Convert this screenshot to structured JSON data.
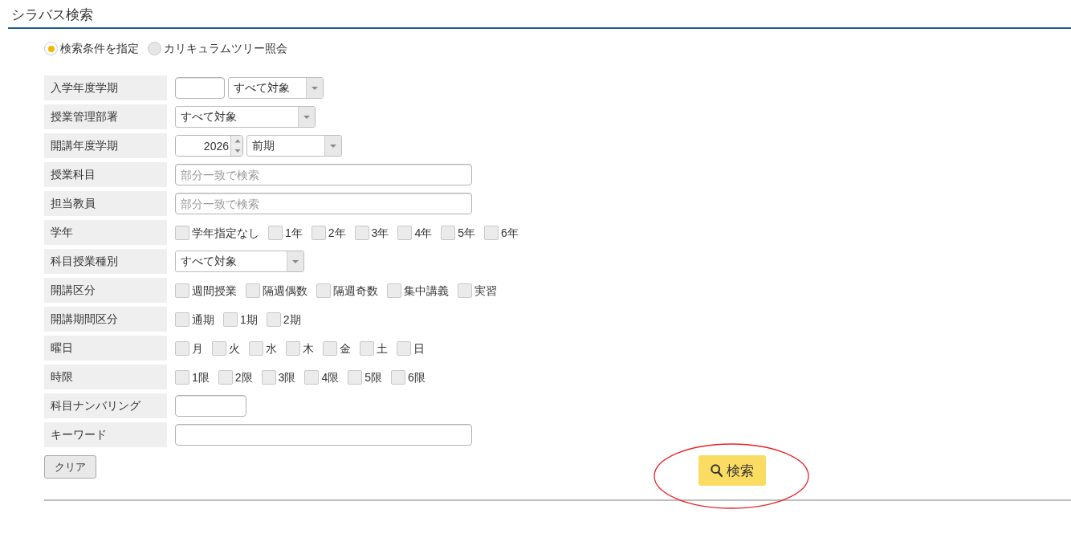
{
  "page_title": "シラバス検索",
  "search_modes": [
    {
      "label": "検索条件を指定",
      "selected": true
    },
    {
      "label": "カリキュラムツリー照会",
      "selected": false
    }
  ],
  "fields": [
    {
      "label": "入学年度学期",
      "controls": [
        {
          "kind": "input"
        },
        {
          "kind": "select",
          "value": "すべて対象"
        }
      ]
    },
    {
      "label": "授業管理部署",
      "controls": [
        {
          "kind": "select",
          "value": "すべて対象"
        }
      ]
    },
    {
      "label": "開講年度学期",
      "controls": [
        {
          "kind": "spinner",
          "value": "2026"
        },
        {
          "kind": "select",
          "value": "前期"
        }
      ]
    },
    {
      "label": "授業科目",
      "controls": [
        {
          "kind": "input",
          "placeholder": "部分一致で検索"
        }
      ]
    },
    {
      "label": "担当教員",
      "controls": [
        {
          "kind": "input",
          "placeholder": "部分一致で検索"
        }
      ]
    },
    {
      "label": "学年",
      "controls": [
        {
          "kind": "checkbox",
          "label": "学年指定なし",
          "checked": false
        },
        {
          "kind": "checkbox",
          "label": "1年",
          "checked": false
        },
        {
          "kind": "checkbox",
          "label": "2年",
          "checked": false
        },
        {
          "kind": "checkbox",
          "label": "3年",
          "checked": false
        },
        {
          "kind": "checkbox",
          "label": "4年",
          "checked": false
        },
        {
          "kind": "checkbox",
          "label": "5年",
          "checked": false
        },
        {
          "kind": "checkbox",
          "label": "6年",
          "checked": false
        }
      ]
    },
    {
      "label": "科目授業種別",
      "controls": [
        {
          "kind": "select",
          "value": "すべて対象"
        }
      ]
    },
    {
      "label": "開講区分",
      "controls": [
        {
          "kind": "checkbox",
          "label": "週間授業",
          "checked": false
        },
        {
          "kind": "checkbox",
          "label": "隔週偶数",
          "checked": false
        },
        {
          "kind": "checkbox",
          "label": "隔週奇数",
          "checked": false
        },
        {
          "kind": "checkbox",
          "label": "集中講義",
          "checked": false
        },
        {
          "kind": "checkbox",
          "label": "実習",
          "checked": false
        }
      ]
    },
    {
      "label": "開講期間区分",
      "controls": [
        {
          "kind": "checkbox",
          "label": "通期",
          "checked": false
        },
        {
          "kind": "checkbox",
          "label": "1期",
          "checked": false
        },
        {
          "kind": "checkbox",
          "label": "2期",
          "checked": false
        }
      ]
    },
    {
      "label": "曜日",
      "controls": [
        {
          "kind": "checkbox",
          "label": "月",
          "checked": false
        },
        {
          "kind": "checkbox",
          "label": "火",
          "checked": false
        },
        {
          "kind": "checkbox",
          "label": "水",
          "checked": false
        },
        {
          "kind": "checkbox",
          "label": "木",
          "checked": false
        },
        {
          "kind": "checkbox",
          "label": "金",
          "checked": false
        },
        {
          "kind": "checkbox",
          "label": "土",
          "checked": false
        },
        {
          "kind": "checkbox",
          "label": "日",
          "checked": false
        }
      ]
    },
    {
      "label": "時限",
      "controls": [
        {
          "kind": "checkbox",
          "label": "1限",
          "checked": false
        },
        {
          "kind": "checkbox",
          "label": "2限",
          "checked": false
        },
        {
          "kind": "checkbox",
          "label": "3限",
          "checked": false
        },
        {
          "kind": "checkbox",
          "label": "4限",
          "checked": false
        },
        {
          "kind": "checkbox",
          "label": "5限",
          "checked": false
        },
        {
          "kind": "checkbox",
          "label": "6限",
          "checked": false
        }
      ]
    },
    {
      "label": "科目ナンバリング",
      "controls": [
        {
          "kind": "input"
        }
      ]
    },
    {
      "label": "キーワード",
      "controls": [
        {
          "kind": "input"
        }
      ]
    }
  ],
  "clear_button": {
    "label": "クリア"
  },
  "search_button": {
    "label": "検索",
    "circled": true
  }
}
